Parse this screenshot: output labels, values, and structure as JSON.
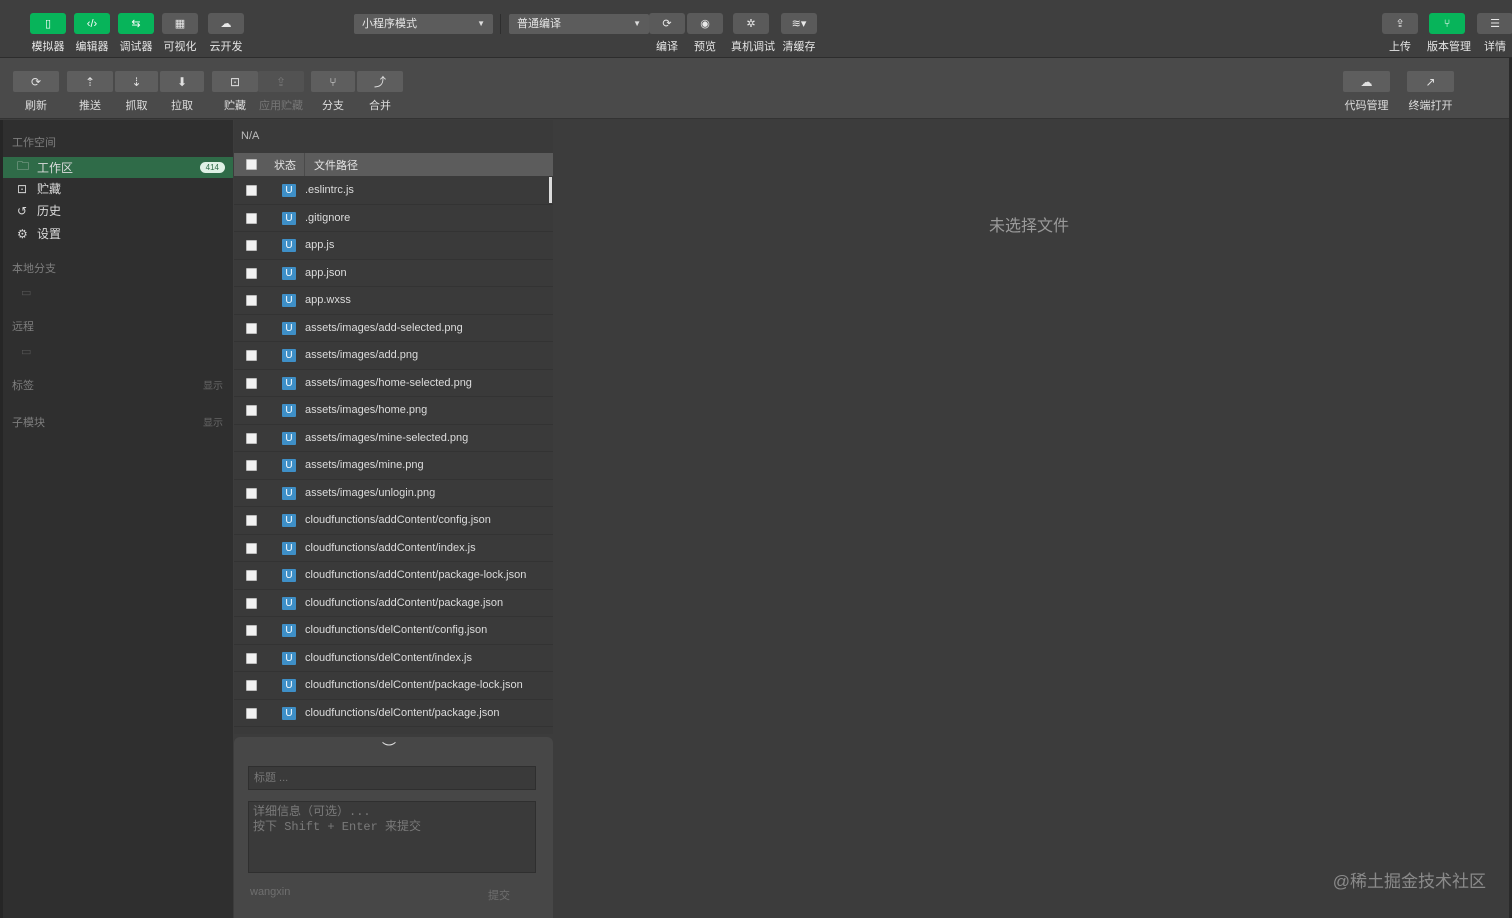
{
  "top_toolbar": {
    "left_buttons": [
      {
        "label": "模拟器",
        "icon": "phone-icon",
        "glyph": "▯",
        "active": true
      },
      {
        "label": "编辑器",
        "icon": "code-icon",
        "glyph": "‹/›",
        "active": true
      },
      {
        "label": "调试器",
        "icon": "debug-icon",
        "glyph": "⇆",
        "active": true
      },
      {
        "label": "可视化",
        "icon": "layout-icon",
        "glyph": "▦",
        "active": false
      },
      {
        "label": "云开发",
        "icon": "cloud-icon",
        "glyph": "☁",
        "active": false
      }
    ],
    "mode_select": "小程序模式",
    "compile_select": "普通编译",
    "action_buttons": [
      {
        "label": "编译",
        "icon": "refresh-icon",
        "glyph": "⟳"
      },
      {
        "label": "预览",
        "icon": "eye-icon",
        "glyph": "◉"
      },
      {
        "label": "真机调试",
        "icon": "bug-icon",
        "glyph": "✲"
      },
      {
        "label": "清缓存",
        "icon": "layers-icon",
        "glyph": "≋▾"
      }
    ],
    "right_buttons": [
      {
        "label": "上传",
        "icon": "upload-icon",
        "glyph": "⇪",
        "active": false
      },
      {
        "label": "版本管理",
        "icon": "git-branch-icon",
        "glyph": "⑂",
        "active": true
      },
      {
        "label": "详情",
        "icon": "menu-icon",
        "glyph": "☰",
        "active": false
      }
    ]
  },
  "git_toolbar": {
    "buttons": [
      {
        "label": "刷新",
        "icon": "refresh-icon",
        "glyph": "⟳",
        "disabled": false
      },
      {
        "label": "推送",
        "icon": "push-icon",
        "glyph": "⇡",
        "disabled": false
      },
      {
        "label": "抓取",
        "icon": "fetch-icon",
        "glyph": "⇣",
        "disabled": false
      },
      {
        "label": "拉取",
        "icon": "pull-icon",
        "glyph": "⬇",
        "disabled": false
      },
      {
        "label": "贮藏",
        "icon": "stash-icon",
        "glyph": "⊡",
        "disabled": false
      },
      {
        "label": "应用贮藏",
        "icon": "apply-stash-icon",
        "glyph": "⇪",
        "disabled": true
      },
      {
        "label": "分支",
        "icon": "branch-icon",
        "glyph": "⑂",
        "disabled": false
      },
      {
        "label": "合并",
        "icon": "merge-icon",
        "glyph": "⤴",
        "disabled": false
      }
    ],
    "right_buttons": [
      {
        "label": "代码管理",
        "icon": "cloud-code-icon",
        "glyph": "☁"
      },
      {
        "label": "终端打开",
        "icon": "external-icon",
        "glyph": "↗"
      }
    ]
  },
  "sidebar": {
    "workspace_title": "工作空间",
    "items": [
      {
        "label": "工作区",
        "icon": "folder-icon",
        "glyph": "🗀",
        "badge": "414",
        "active": true
      },
      {
        "label": "贮藏",
        "icon": "stash-icon",
        "glyph": "⊡",
        "badge": "",
        "active": false
      },
      {
        "label": "历史",
        "icon": "history-icon",
        "glyph": "↺",
        "badge": "",
        "active": false
      },
      {
        "label": "设置",
        "icon": "gear-icon",
        "glyph": "⚙",
        "badge": "",
        "active": false
      }
    ],
    "local_branch_title": "本地分支",
    "remote_title": "远程",
    "tags_title": "标签",
    "tags_action": "显示",
    "submodule_title": "子模块",
    "submodule_action": "显示"
  },
  "file_panel": {
    "branch": "N/A",
    "col_status": "状态",
    "col_path": "文件路径",
    "status_badge": "U",
    "files": [
      ".eslintrc.js",
      ".gitignore",
      "app.js",
      "app.json",
      "app.wxss",
      "assets/images/add-selected.png",
      "assets/images/add.png",
      "assets/images/home-selected.png",
      "assets/images/home.png",
      "assets/images/mine-selected.png",
      "assets/images/mine.png",
      "assets/images/unlogin.png",
      "cloudfunctions/addContent/config.json",
      "cloudfunctions/addContent/index.js",
      "cloudfunctions/addContent/package-lock.json",
      "cloudfunctions/addContent/package.json",
      "cloudfunctions/delContent/config.json",
      "cloudfunctions/delContent/index.js",
      "cloudfunctions/delContent/package-lock.json",
      "cloudfunctions/delContent/package.json"
    ]
  },
  "commit_panel": {
    "title_placeholder": "标题 ...",
    "desc_placeholder": "详细信息（可选）...\n按下 Shift + Enter 来提交",
    "author": "wangxin",
    "submit_label": "提交"
  },
  "detail": {
    "empty_message": "未选择文件",
    "watermark": "@稀土掘金技术社区"
  }
}
